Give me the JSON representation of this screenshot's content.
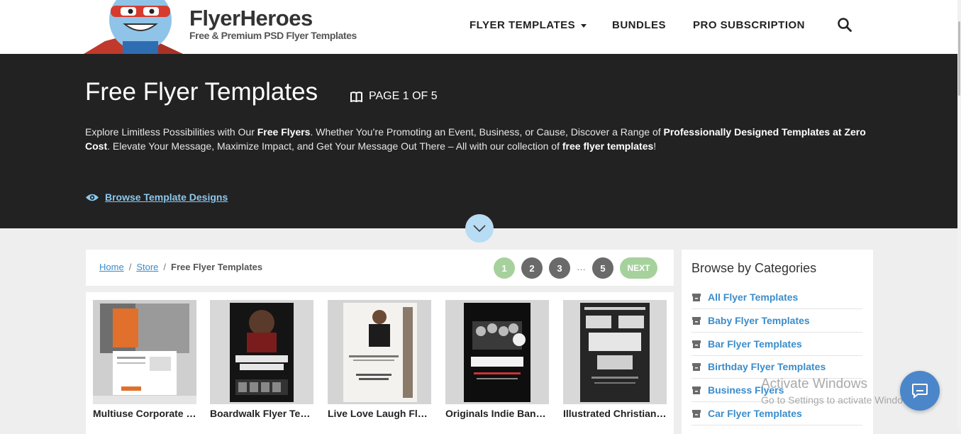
{
  "header": {
    "brand_name": "FlyerHeroes",
    "brand_tagline": "Free & Premium PSD Flyer Templates",
    "nav": [
      {
        "label": "FLYER TEMPLATES",
        "has_dropdown": true
      },
      {
        "label": "BUNDLES"
      },
      {
        "label": "PRO SUBSCRIPTION"
      }
    ],
    "search_icon": "search-icon"
  },
  "hero": {
    "title": "Free Flyer Templates",
    "page_indicator": "PAGE 1 OF 5",
    "description": [
      {
        "text": "Explore Limitless Possibilities with Our ",
        "bold": false
      },
      {
        "text": "Free Flyers",
        "bold": true
      },
      {
        "text": ". Whether You’re Promoting an Event, Business, or Cause, Discover a Range of ",
        "bold": false
      },
      {
        "text": "Professionally Designed Templates at Zero Cost",
        "bold": true
      },
      {
        "text": ". Elevate Your Message, Maximize Impact, and Get Your Message Out There – All with our collection of ",
        "bold": false
      },
      {
        "text": "free flyer templates",
        "bold": true
      },
      {
        "text": "!",
        "bold": false
      }
    ],
    "browse_link": "Browse Template Designs"
  },
  "breadcrumb": {
    "items": [
      "Home",
      "Store"
    ],
    "current": "Free Flyer Templates"
  },
  "pagination": {
    "pages": [
      "1",
      "2",
      "3"
    ],
    "ellipsis": "…",
    "last": "5",
    "next": "NEXT",
    "current": 1
  },
  "products": [
    {
      "title": "Multiuse Corporate Flyer Template"
    },
    {
      "title": "Boardwalk Flyer Template"
    },
    {
      "title": "Live Love Laugh Flyer"
    },
    {
      "title": "Originals Indie Band Flyer"
    },
    {
      "title": "Illustrated Christian Flyer"
    }
  ],
  "sidebar": {
    "title": "Browse by Categories",
    "categories": [
      "All Flyer Templates",
      "Baby Flyer Templates",
      "Bar Flyer Templates",
      "Birthday Flyer Templates",
      "Business Flyers",
      "Car Flyer Templates"
    ]
  },
  "windows_watermark": {
    "line1": "Activate Windows",
    "line2": "Go to Settings to activate Windows."
  },
  "colors": {
    "hero_bg": "#222222",
    "link_blue": "#3a8ccb",
    "pagination_active": "#a6d19c",
    "chat_button": "#4a86c9"
  }
}
